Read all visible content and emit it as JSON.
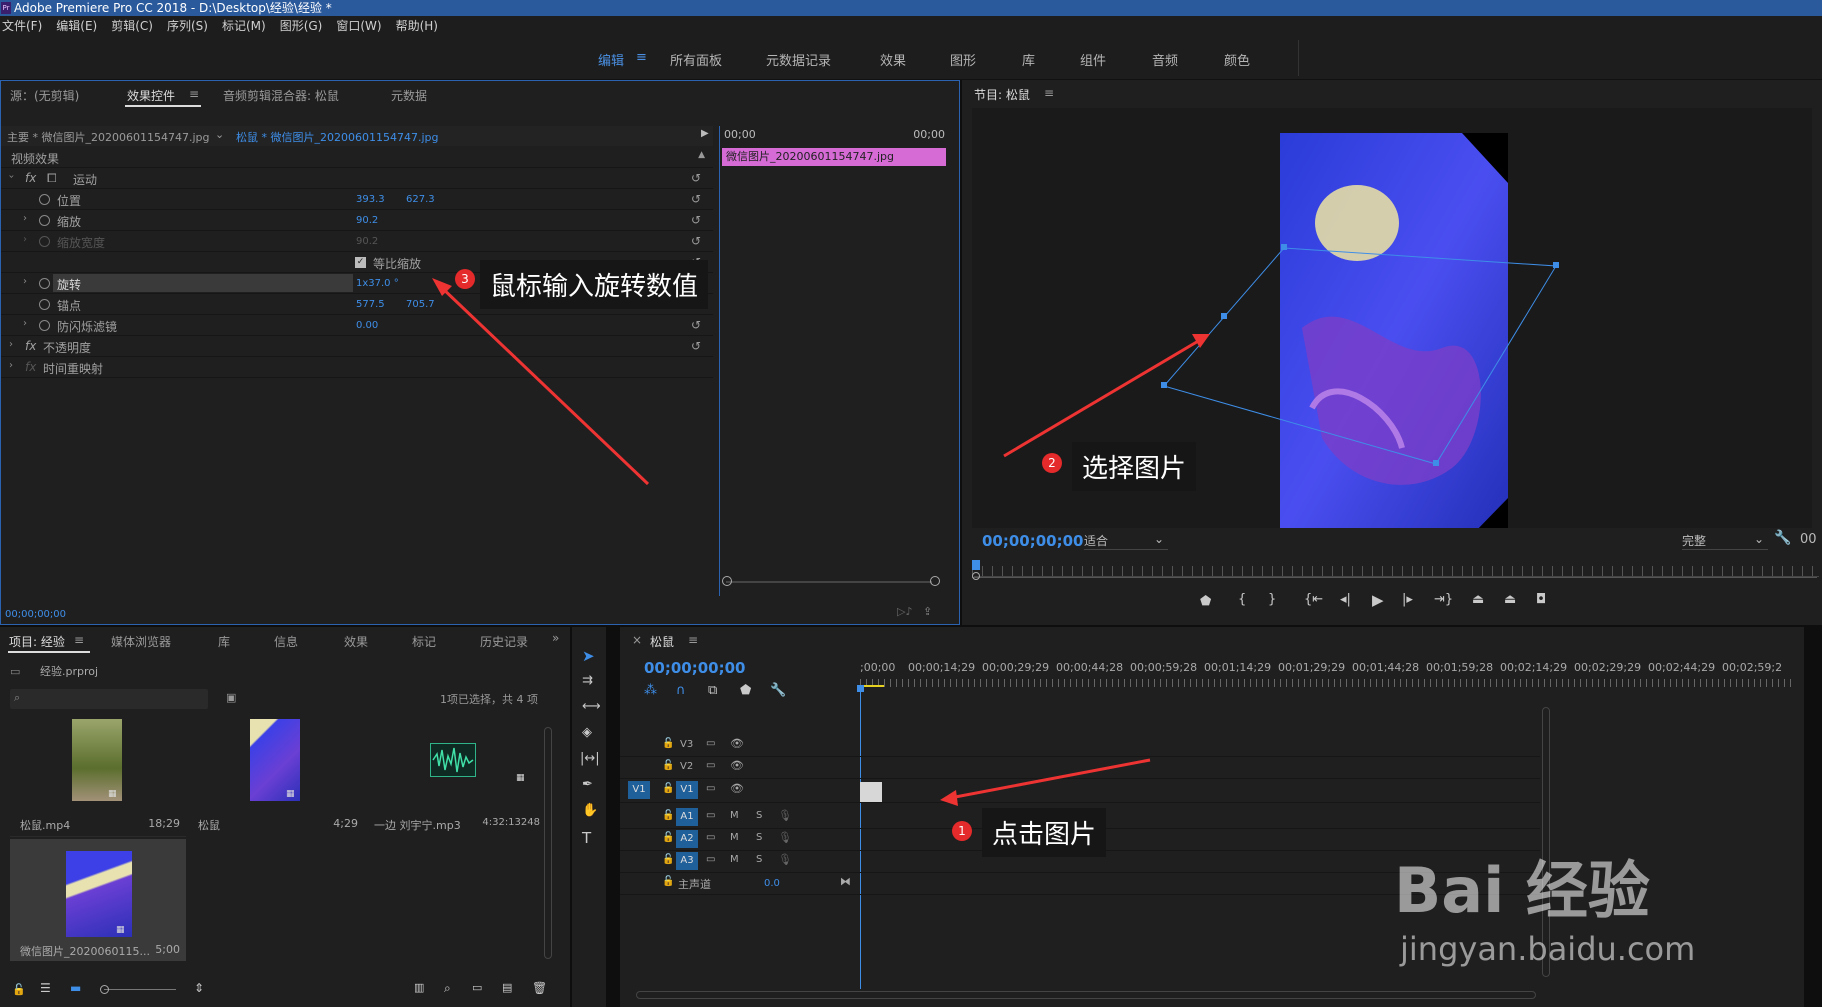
{
  "window": {
    "title": "Adobe Premiere Pro CC 2018 - D:\\Desktop\\经验\\经验 *",
    "app_icon": "Pr"
  },
  "menu": [
    "文件(F)",
    "编辑(E)",
    "剪辑(C)",
    "序列(S)",
    "标记(M)",
    "图形(G)",
    "窗口(W)",
    "帮助(H)"
  ],
  "workspaces": [
    "编辑",
    "所有面板",
    "元数据记录",
    "效果",
    "图形",
    "库",
    "组件",
    "音频",
    "颜色"
  ],
  "source_panel": {
    "tabs": [
      "源：(无剪辑)",
      "效果控件",
      "音频剪辑混合器: 松鼠",
      "元数据"
    ],
    "master_label": "主要 * 微信图片_20200601154747.jpg",
    "clip_label": "松鼠 * 微信图片_20200601154747.jpg",
    "section": "视频效果",
    "motion": "运动",
    "position_label": "位置",
    "position_x": "393.3",
    "position_y": "627.3",
    "scale_label": "缩放",
    "scale_value": "90.2",
    "scale_width_label": "缩放宽度",
    "scale_width_value": "90.2",
    "uniform_label": "等比缩放",
    "rotation_label": "旋转",
    "rotation_value": "1x37.0 °",
    "anchor_label": "锚点",
    "anchor_x": "577.5",
    "anchor_y": "705.7",
    "flicker_label": "防闪烁滤镜",
    "flicker_value": "0.00",
    "opacity_label": "不透明度",
    "timeremap_label": "时间重映射",
    "mini_time_start": "00;00",
    "mini_time_end": "00;00",
    "mini_clip_name": "微信图片_20200601154747.jpg",
    "timecode": "00;00;00;00"
  },
  "program_panel": {
    "title": "节目: 松鼠",
    "timecode": "00;00;00;00",
    "fit": "适合",
    "quality": "完整",
    "right_tc": "00"
  },
  "project_panel": {
    "tabs": [
      "项目: 经验",
      "媒体浏览器",
      "库",
      "信息",
      "效果",
      "标记",
      "历史记录"
    ],
    "project_file": "经验.prproj",
    "selection_info": "1项已选择，共 4 项",
    "items": [
      {
        "name": "松鼠.mp4",
        "duration": "18;29"
      },
      {
        "name": "松鼠",
        "duration": "4;29"
      },
      {
        "name": "一边 刘宇宁.mp3",
        "duration": "4:32:13248"
      },
      {
        "name": "微信图片_2020060115...",
        "duration": "5;00"
      }
    ]
  },
  "timeline": {
    "title": "松鼠",
    "timecode": "00;00;00;00",
    "ruler": [
      ";00;00",
      "00;00;14;29",
      "00;00;29;29",
      "00;00;44;28",
      "00;00;59;28",
      "00;01;14;29",
      "00;01;29;29",
      "00;01;44;28",
      "00;01;59;28",
      "00;02;14;29",
      "00;02;29;29",
      "00;02;44;29",
      "00;02;59;2"
    ],
    "video_tracks": [
      "V3",
      "V2",
      "V1"
    ],
    "audio_tracks": [
      "A1",
      "A2",
      "A3"
    ],
    "source_v": "V1",
    "master": "主声道",
    "master_value": "0.0"
  },
  "annotations": {
    "a1": {
      "num": "1",
      "text": "点击图片"
    },
    "a2": {
      "num": "2",
      "text": "选择图片"
    },
    "a3": {
      "num": "3",
      "text": "鼠标输入旋转数值"
    }
  },
  "watermark": {
    "brand": "Bai 经验",
    "url": "jingyan.baidu.com"
  },
  "colors": {
    "accent": "#3e8ee8",
    "clip_pink": "#d66bd6",
    "annotation_red": "#e42a2a"
  }
}
